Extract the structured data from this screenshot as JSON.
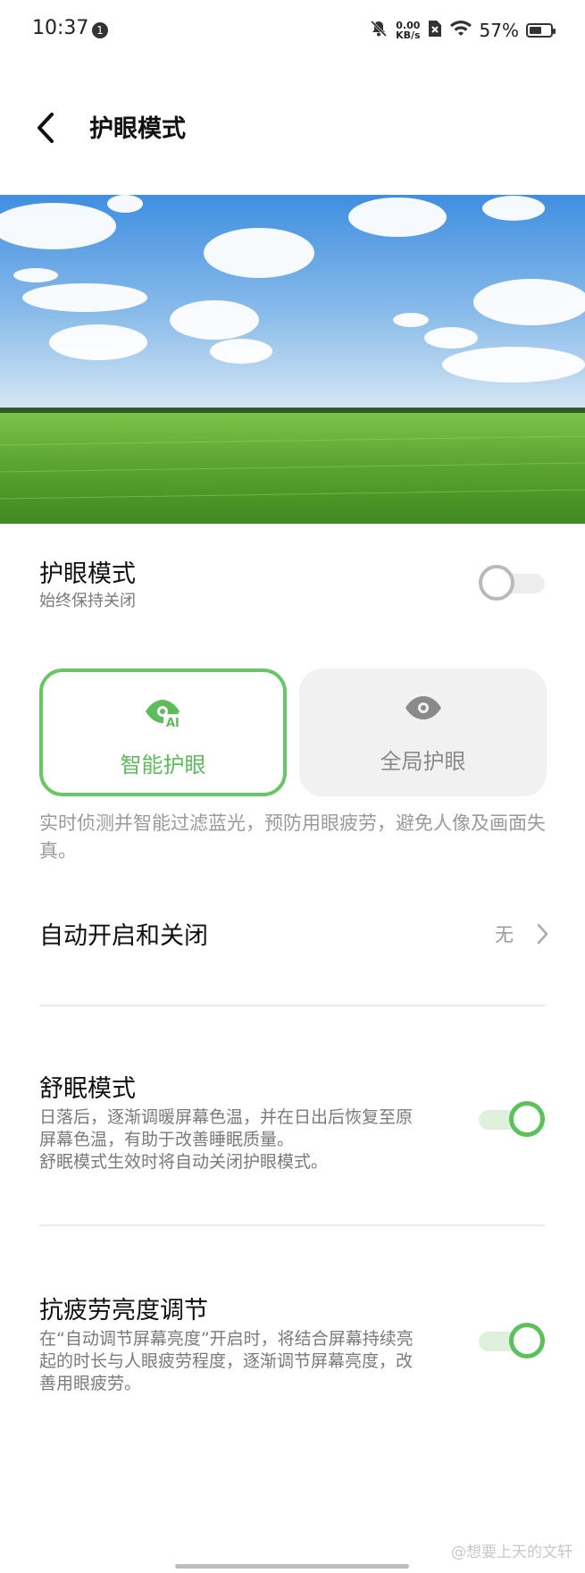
{
  "status_bar": {
    "time": "10:37",
    "notification_badge": "1",
    "net_speed_value": "0.00",
    "net_speed_unit": "KB/s",
    "battery_percent": "57%",
    "battery_level": 0.57
  },
  "header": {
    "title": "护眼模式",
    "back_icon": "chevron-left-icon"
  },
  "eye_mode": {
    "title": "护眼模式",
    "subtitle": "始终保持关闭",
    "enabled": false
  },
  "modes": [
    {
      "label": "智能护眼",
      "icon": "eye-ai-icon",
      "selected": true
    },
    {
      "label": "全局护眼",
      "icon": "eye-icon",
      "selected": false
    }
  ],
  "mode_description": "实时侦测并智能过滤蓝光，预防用眼疲劳，避免人像及画面失真。",
  "auto_schedule": {
    "title": "自动开启和关闭",
    "value": "无"
  },
  "sleep_mode": {
    "title": "舒眠模式",
    "desc_line1": "日落后，逐渐调暖屏幕色温，并在日出后恢复至原",
    "desc_line2": "屏幕色温，有助于改善睡眠质量。",
    "desc_line3": "舒眠模式生效时将自动关闭护眼模式。",
    "enabled": true
  },
  "anti_fatigue": {
    "title": "抗疲劳亮度调节",
    "desc_line1": "在“自动调节屏幕亮度”开启时，将结合屏幕持续亮",
    "desc_line2": "起的时长与人眼疲劳程度，逐渐调节屏幕亮度，改",
    "desc_line3": "善用眼疲劳。",
    "enabled": true
  },
  "watermark": "@想要上天的文轩",
  "colors": {
    "accent_green": "#5cc15b",
    "muted_text": "#9a9a9a"
  }
}
